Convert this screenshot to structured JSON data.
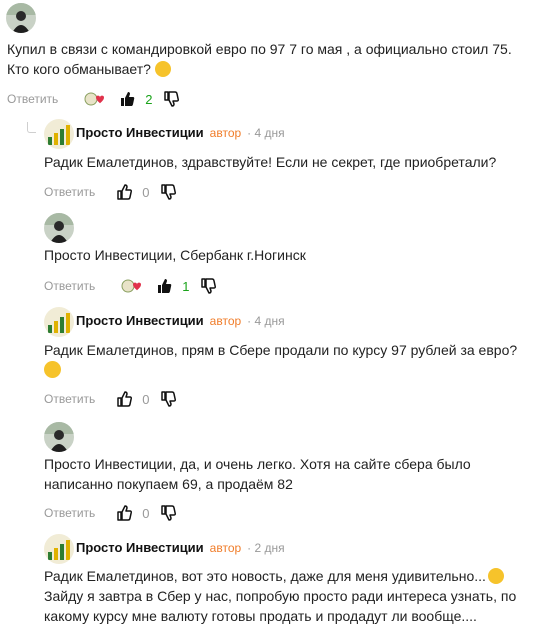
{
  "comments": [
    {
      "text_lines": [
        "Купил в связи с командировкой евро по 97 7 го мая , а официально стоил 75.",
        "Кто кого обманывает?"
      ],
      "reply_label": "Ответить",
      "likes": "2",
      "liked": true
    },
    {
      "author": "Просто Инвестиции",
      "badge": "автор",
      "time": "4 дня",
      "text_lines": [
        "Радик Емалетдинов, здравствуйте! Если не секрет, где приобретали?"
      ],
      "reply_label": "Ответить",
      "likes": "0"
    },
    {
      "text_lines": [
        "Просто Инвестиции, Сбербанк г.Ногинск"
      ],
      "reply_label": "Ответить",
      "likes": "1",
      "liked": true
    },
    {
      "author": "Просто Инвестиции",
      "badge": "автор",
      "time": "4 дня",
      "text_lines": [
        "Радик Емалетдинов, прям в Сбере продали по курсу 97 рублей за евро?"
      ],
      "reply_label": "Ответить",
      "likes": "0"
    },
    {
      "text_lines": [
        "Просто Инвестиции, да, и очень легко. Хотя на сайте сбера было",
        "написанно покупаем 69, а продаём 82"
      ],
      "reply_label": "Ответить",
      "likes": "0"
    },
    {
      "author": "Просто Инвестиции",
      "badge": "автор",
      "time": "2 дня",
      "text_lines": [
        "Радик Емалетдинов, вот это новость, даже для меня удивительно...",
        "Зайду я завтра в Сбер у нас, попробую просто ради интереса узнать, по",
        "какому курсу мне валюту готовы продать и продадут ли вообще...."
      ]
    }
  ],
  "colors": {
    "author_badge": "#f07d2a",
    "positive_count": "#1aa31a",
    "muted": "#999999"
  }
}
